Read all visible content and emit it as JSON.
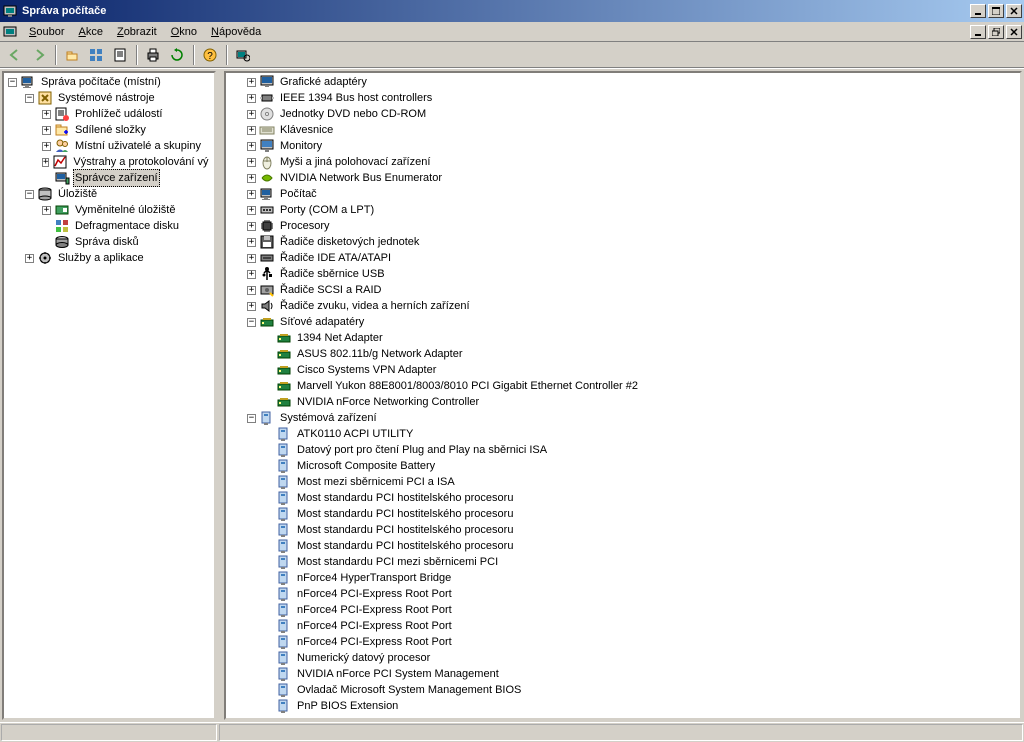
{
  "window": {
    "title": "Správa počítače"
  },
  "menu": {
    "items": [
      "Soubor",
      "Akce",
      "Zobrazit",
      "Okno",
      "Nápověda"
    ],
    "underlines": [
      "S",
      "A",
      "Z",
      "O",
      "N"
    ]
  },
  "left_tree": [
    {
      "indent": 0,
      "toggle": "-",
      "icon": "computer",
      "label": "Správa počítače (místní)"
    },
    {
      "indent": 1,
      "toggle": "-",
      "icon": "tools",
      "label": "Systémové nástroje"
    },
    {
      "indent": 2,
      "toggle": "+",
      "icon": "event",
      "label": "Prohlížeč událostí"
    },
    {
      "indent": 2,
      "toggle": "+",
      "icon": "folder-share",
      "label": "Sdílené složky"
    },
    {
      "indent": 2,
      "toggle": "+",
      "icon": "users",
      "label": "Místní uživatelé a skupiny"
    },
    {
      "indent": 2,
      "toggle": "+",
      "icon": "perf",
      "label": "Výstrahy a protokolování vý"
    },
    {
      "indent": 2,
      "toggle": " ",
      "icon": "devmgr",
      "label": "Správce zařízení",
      "selected": true
    },
    {
      "indent": 1,
      "toggle": "-",
      "icon": "storage",
      "label": "Úložiště"
    },
    {
      "indent": 2,
      "toggle": "+",
      "icon": "removable",
      "label": "Vyměnitelné úložiště"
    },
    {
      "indent": 2,
      "toggle": " ",
      "icon": "defrag",
      "label": "Defragmentace disku"
    },
    {
      "indent": 2,
      "toggle": " ",
      "icon": "diskmgr",
      "label": "Správa disků"
    },
    {
      "indent": 1,
      "toggle": "+",
      "icon": "services",
      "label": "Služby a aplikace"
    }
  ],
  "right_tree": [
    {
      "indent": 0,
      "toggle": "+",
      "icon": "display",
      "label": "Grafické adaptéry"
    },
    {
      "indent": 0,
      "toggle": "+",
      "icon": "ieee",
      "label": "IEEE 1394 Bus host controllers"
    },
    {
      "indent": 0,
      "toggle": "+",
      "icon": "cdrom",
      "label": "Jednotky DVD nebo CD-ROM"
    },
    {
      "indent": 0,
      "toggle": "+",
      "icon": "keyboard",
      "label": "Klávesnice"
    },
    {
      "indent": 0,
      "toggle": "+",
      "icon": "monitor",
      "label": "Monitory"
    },
    {
      "indent": 0,
      "toggle": "+",
      "icon": "mouse",
      "label": "Myši a jiná polohovací zařízení"
    },
    {
      "indent": 0,
      "toggle": "+",
      "icon": "nvidia",
      "label": "NVIDIA Network Bus Enumerator"
    },
    {
      "indent": 0,
      "toggle": "+",
      "icon": "computer",
      "label": "Počítač"
    },
    {
      "indent": 0,
      "toggle": "+",
      "icon": "port",
      "label": "Porty (COM a LPT)"
    },
    {
      "indent": 0,
      "toggle": "+",
      "icon": "cpu",
      "label": "Procesory"
    },
    {
      "indent": 0,
      "toggle": "+",
      "icon": "floppy",
      "label": "Řadiče disketových jednotek"
    },
    {
      "indent": 0,
      "toggle": "+",
      "icon": "ide",
      "label": "Řadiče IDE ATA/ATAPI"
    },
    {
      "indent": 0,
      "toggle": "+",
      "icon": "usb",
      "label": "Řadiče sběrnice USB"
    },
    {
      "indent": 0,
      "toggle": "+",
      "icon": "scsi",
      "label": "Řadiče SCSI a RAID"
    },
    {
      "indent": 0,
      "toggle": "+",
      "icon": "sound",
      "label": "Řadiče zvuku, videa a herních zařízení"
    },
    {
      "indent": 0,
      "toggle": "-",
      "icon": "network",
      "label": "Síťové adapatéry"
    },
    {
      "indent": 1,
      "toggle": " ",
      "icon": "netadapter",
      "label": "1394 Net Adapter"
    },
    {
      "indent": 1,
      "toggle": " ",
      "icon": "netadapter",
      "label": "ASUS 802.11b/g Network Adapter"
    },
    {
      "indent": 1,
      "toggle": " ",
      "icon": "netadapter",
      "label": "Cisco Systems VPN Adapter"
    },
    {
      "indent": 1,
      "toggle": " ",
      "icon": "netadapter",
      "label": "Marvell Yukon 88E8001/8003/8010 PCI Gigabit Ethernet Controller #2"
    },
    {
      "indent": 1,
      "toggle": " ",
      "icon": "netadapter",
      "label": "NVIDIA nForce Networking Controller"
    },
    {
      "indent": 0,
      "toggle": "-",
      "icon": "system",
      "label": "Systémová zařízení"
    },
    {
      "indent": 1,
      "toggle": " ",
      "icon": "sysdev",
      "label": "ATK0110 ACPI UTILITY"
    },
    {
      "indent": 1,
      "toggle": " ",
      "icon": "sysdev",
      "label": "Datový port pro čtení Plug and Play na sběrnici ISA"
    },
    {
      "indent": 1,
      "toggle": " ",
      "icon": "sysdev",
      "label": "Microsoft Composite Battery"
    },
    {
      "indent": 1,
      "toggle": " ",
      "icon": "sysdev",
      "label": "Most mezi sběrnicemi PCI a ISA"
    },
    {
      "indent": 1,
      "toggle": " ",
      "icon": "sysdev",
      "label": "Most standardu PCI hostitelského procesoru"
    },
    {
      "indent": 1,
      "toggle": " ",
      "icon": "sysdev",
      "label": "Most standardu PCI hostitelského procesoru"
    },
    {
      "indent": 1,
      "toggle": " ",
      "icon": "sysdev",
      "label": "Most standardu PCI hostitelského procesoru"
    },
    {
      "indent": 1,
      "toggle": " ",
      "icon": "sysdev",
      "label": "Most standardu PCI hostitelského procesoru"
    },
    {
      "indent": 1,
      "toggle": " ",
      "icon": "sysdev",
      "label": "Most standardu PCI mezi sběrnicemi PCI"
    },
    {
      "indent": 1,
      "toggle": " ",
      "icon": "sysdev",
      "label": "nForce4 HyperTransport Bridge"
    },
    {
      "indent": 1,
      "toggle": " ",
      "icon": "sysdev",
      "label": "nForce4 PCI-Express Root Port"
    },
    {
      "indent": 1,
      "toggle": " ",
      "icon": "sysdev",
      "label": "nForce4 PCI-Express Root Port"
    },
    {
      "indent": 1,
      "toggle": " ",
      "icon": "sysdev",
      "label": "nForce4 PCI-Express Root Port"
    },
    {
      "indent": 1,
      "toggle": " ",
      "icon": "sysdev",
      "label": "nForce4 PCI-Express Root Port"
    },
    {
      "indent": 1,
      "toggle": " ",
      "icon": "sysdev",
      "label": "Numerický datový procesor"
    },
    {
      "indent": 1,
      "toggle": " ",
      "icon": "sysdev",
      "label": "NVIDIA nForce PCI System Management"
    },
    {
      "indent": 1,
      "toggle": " ",
      "icon": "sysdev",
      "label": "Ovladač Microsoft System Management BIOS"
    },
    {
      "indent": 1,
      "toggle": " ",
      "icon": "sysdev",
      "label": "PnP BIOS Extension"
    }
  ]
}
